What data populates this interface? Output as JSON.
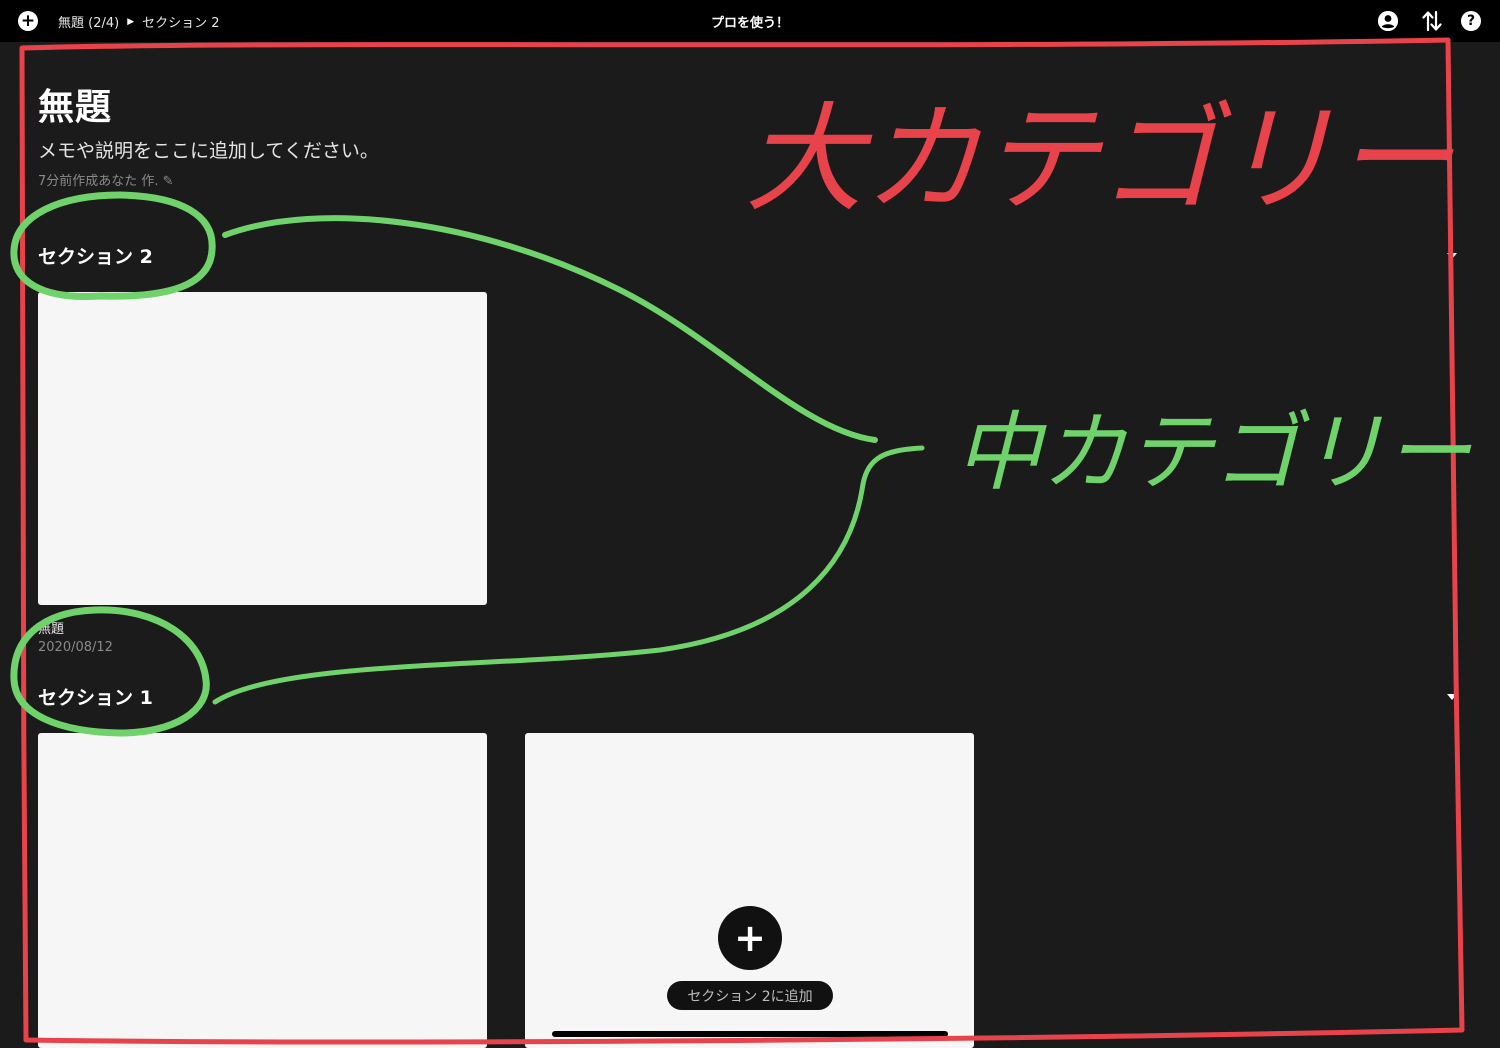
{
  "topbar": {
    "breadcrumb": {
      "board": "無題 (2/4)",
      "section": "セクション 2"
    },
    "pro_label": "プロを使う！"
  },
  "board": {
    "title": "無題",
    "description": "メモや説明をここに追加してください。",
    "meta": "7分前作成あなた 作. ✎"
  },
  "sections": [
    {
      "title": "セクション 2",
      "cards": [
        {
          "name": "無題",
          "date": "2020/08/12"
        }
      ]
    },
    {
      "title": "セクション 1",
      "add_label": "セクション 2に追加"
    }
  ],
  "annotations": {
    "large_category": "大カテゴリー",
    "middle_category": "中カテゴリー",
    "large_color": "#e8434b",
    "middle_color": "#6fd26a"
  },
  "icons": {
    "add": "plus-icon",
    "account": "account-icon",
    "sort": "sort-arrows-icon",
    "help": "help-icon"
  }
}
